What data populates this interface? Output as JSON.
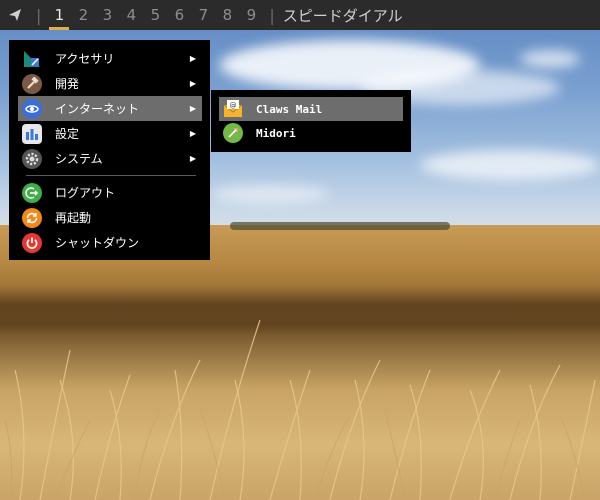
{
  "panel": {
    "workspaces": [
      "1",
      "2",
      "3",
      "4",
      "5",
      "6",
      "7",
      "8",
      "9"
    ],
    "active_workspace": "1",
    "window_title": "スピードダイアル",
    "accent": "#e2b04a"
  },
  "main_menu": {
    "items": [
      {
        "label": "アクセサリ",
        "icon": "accessories-icon",
        "submenu": true
      },
      {
        "label": "開発",
        "icon": "hammer-icon",
        "submenu": true
      },
      {
        "label": "インターネット",
        "icon": "internet-globe-icon",
        "submenu": true,
        "highlighted": true
      },
      {
        "label": "設定",
        "icon": "settings-icon",
        "submenu": true
      },
      {
        "label": "システム",
        "icon": "system-gear-icon",
        "submenu": true
      }
    ],
    "session": [
      {
        "label": "ログアウト",
        "icon": "logout-icon"
      },
      {
        "label": "再起動",
        "icon": "restart-icon"
      },
      {
        "label": "シャットダウン",
        "icon": "shutdown-icon"
      }
    ],
    "arrow_glyph": "▶"
  },
  "internet_submenu": {
    "items": [
      {
        "label": "Claws Mail",
        "icon": "mail-icon",
        "highlighted": true
      },
      {
        "label": "Midori",
        "icon": "midori-browser-icon"
      }
    ]
  }
}
